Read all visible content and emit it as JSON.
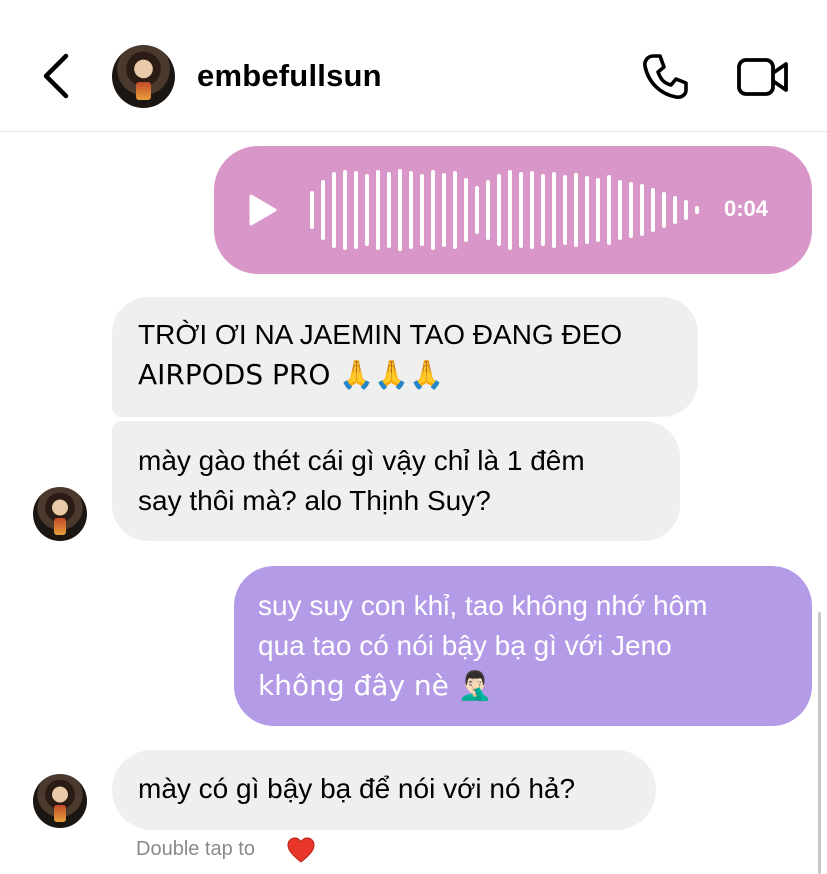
{
  "header": {
    "username": "embefullsun",
    "icons": {
      "back": "chevron-left-icon",
      "call": "phone-icon",
      "video": "video-camera-icon"
    }
  },
  "messages": {
    "voice": {
      "duration": "0:04",
      "color": "#d996c9"
    },
    "m1": {
      "line1": "TRỜI ƠI NA JAEMIN TAO ĐANG ĐEO",
      "line2": "AIRPODS PRO 🙏🙏🙏"
    },
    "m2": {
      "line1": "mày gào thét cái gì vậy chỉ là 1 đêm",
      "line2": "say thôi mà? alo Thịnh Suy?"
    },
    "m3": {
      "line1": "suy suy con khỉ, tao không nhớ hôm",
      "line2": "qua tao có nói bậy bạ gì với Jeno",
      "line3": "không đây nè 🤦🏻‍♂️",
      "color": "#b39be8"
    },
    "m4": {
      "text": "mày có gì bậy bạ để nói với nó hả?"
    }
  },
  "footer": {
    "hint": "Double tap to",
    "heart_icon": "red-heart-icon"
  }
}
